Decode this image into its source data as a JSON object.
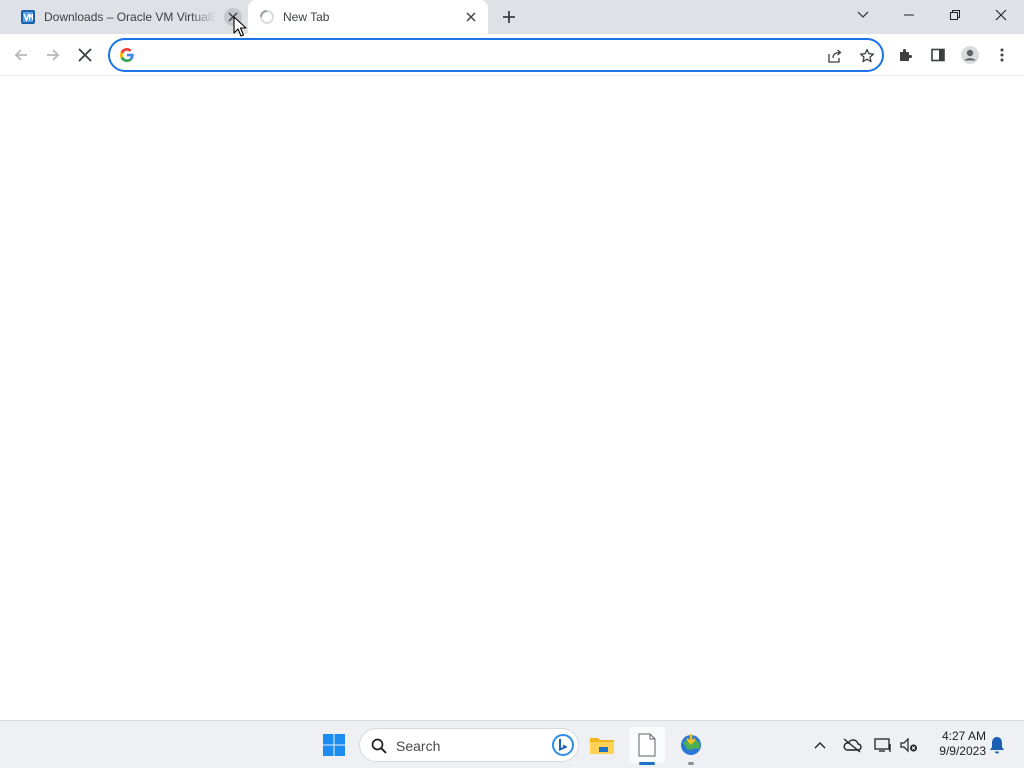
{
  "browser": {
    "tabs": [
      {
        "title": "Downloads – Oracle VM VirtualBox",
        "icon": "virtualbox-icon",
        "active": false
      },
      {
        "title": "New Tab",
        "icon": "loading-spinner-icon",
        "active": true
      }
    ],
    "omnibox": {
      "value": "",
      "placeholder": ""
    }
  },
  "taskbar": {
    "search_label": "Search",
    "clock": {
      "time": "4:27 AM",
      "date": "9/9/2023"
    }
  },
  "colors": {
    "accent": "#1a73e8",
    "tabstrip": "#dee1e6",
    "taskbar": "#eef0f4"
  }
}
